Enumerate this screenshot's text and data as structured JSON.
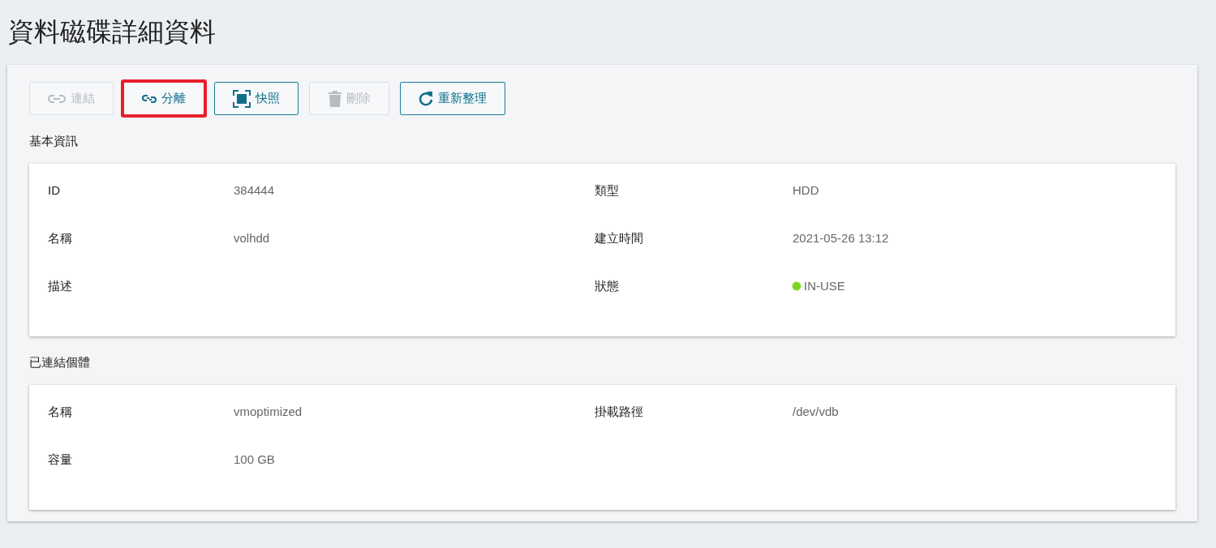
{
  "page_title": "資料磁碟詳細資料",
  "toolbar": [
    {
      "kind": "link",
      "label": "連結",
      "disabled": true,
      "highlighted": false
    },
    {
      "kind": "unlink",
      "label": "分離",
      "disabled": false,
      "highlighted": true
    },
    {
      "kind": "snapshot",
      "label": "快照",
      "disabled": false,
      "highlighted": false
    },
    {
      "kind": "trash",
      "label": "刪除",
      "disabled": true,
      "highlighted": false
    },
    {
      "kind": "refresh",
      "label": "重新整理",
      "disabled": false,
      "highlighted": false
    }
  ],
  "sections": [
    {
      "title": "基本資訊",
      "fields": [
        {
          "label": "ID",
          "value": "384444"
        },
        {
          "label": "類型",
          "value": "HDD"
        },
        {
          "label": "名稱",
          "value": "volhdd"
        },
        {
          "label": "建立時間",
          "value": "2021-05-26 13:12"
        },
        {
          "label": "描述"
        },
        {
          "label": "狀態",
          "value": "IN-USE",
          "color": "#7ed321"
        }
      ]
    },
    {
      "title": "已連結個體",
      "fields": [
        {
          "label": "名稱",
          "value": "vmoptimized"
        },
        {
          "label": "掛載路徑",
          "value": "/dev/vdb"
        },
        {
          "label": "容量",
          "value": "100 GB"
        }
      ]
    }
  ]
}
